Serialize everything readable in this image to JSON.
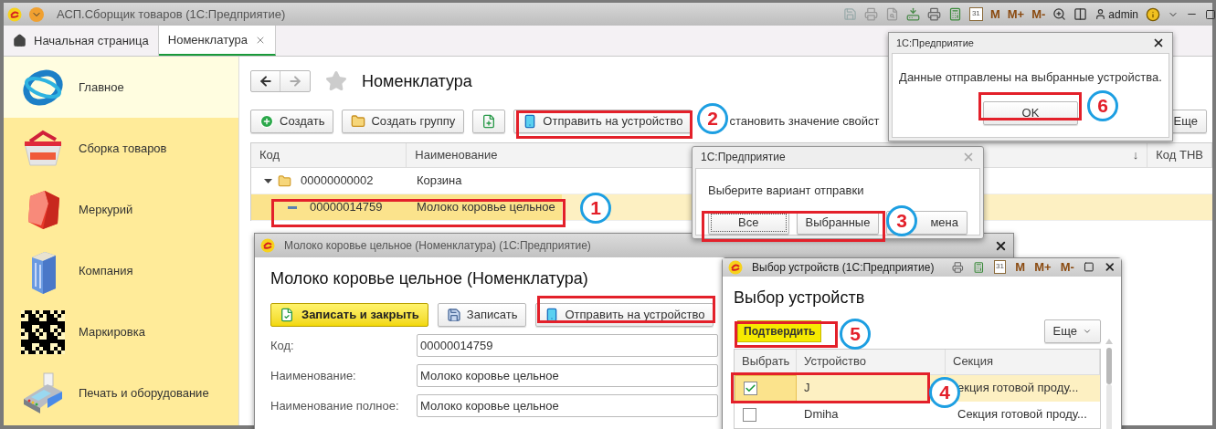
{
  "app_window": {
    "title": "АСП.Сборщик товаров  (1С:Предприятие)",
    "calendar_day": "31",
    "memory_keys": [
      "M",
      "M+",
      "M-"
    ],
    "user": "admin"
  },
  "tabs": [
    {
      "label": "Начальная страница",
      "selected": false,
      "kind": "home"
    },
    {
      "label": "Номенклатура",
      "selected": true,
      "kind": "page"
    }
  ],
  "sidebar": {
    "items": [
      {
        "label": "Главное",
        "selected": true,
        "kind": "globe"
      },
      {
        "label": "Сборка товаров",
        "selected": false,
        "kind": "basket"
      },
      {
        "label": "Меркурий",
        "selected": false,
        "kind": "cube"
      },
      {
        "label": "Компания",
        "selected": false,
        "kind": "building"
      },
      {
        "label": "Маркировка",
        "selected": false,
        "kind": "code"
      },
      {
        "label": "Печать и оборудование",
        "selected": false,
        "kind": "terminal"
      }
    ]
  },
  "list_form": {
    "title": "Номенклатура",
    "toolbar": [
      {
        "label": "Создать",
        "kind": "create"
      },
      {
        "label": "Создать группу",
        "kind": "group"
      },
      {
        "kind": "copy"
      },
      {
        "label": "Отправить на устройство",
        "kind": "send"
      },
      {
        "label": "становить значение свойст",
        "kind": "plain"
      }
    ],
    "more": "Еще",
    "columns": [
      {
        "label": "Код"
      },
      {
        "label": "Наименование",
        "sort": "↓"
      },
      {
        "label": "Код ТНВ"
      }
    ],
    "rows": [
      {
        "code": "00000000002",
        "name": "Корзина",
        "kind": "group",
        "expanded": true,
        "selected": false,
        "children": [
          {
            "code": "00000014759",
            "name": "Молоко коровье цельное",
            "kind": "item",
            "selected": true
          }
        ]
      }
    ]
  },
  "item_window": {
    "title": "Молоко коровье цельное (Номенклатура)  (1С:Предприятие)",
    "heading": "Молоко коровье цельное (Номенклатура)",
    "buttons": [
      {
        "label": "Записать и закрыть",
        "kind": "primary"
      },
      {
        "label": "Записать",
        "kind": "save"
      },
      {
        "label": "Отправить на устройство",
        "kind": "send"
      }
    ],
    "fields": [
      {
        "label": "Код:",
        "value": "00000014759"
      },
      {
        "label": "Наименование:",
        "value": "Молоко коровье цельное"
      },
      {
        "label": "Наименование полное:",
        "value": "Молоко коровье цельное"
      }
    ]
  },
  "choice_dialog": {
    "title": "1С:Предприятие",
    "message": "Выберите вариант отправки",
    "buttons": [
      {
        "label": "Все",
        "focused": true
      },
      {
        "label": "Выбранные",
        "focused": false
      },
      {
        "label": "мена",
        "focused": false
      }
    ]
  },
  "devices_window": {
    "title": "Выбор устройств  (1С:Предприятие)",
    "calendar_day": "31",
    "memory_keys": [
      "M",
      "M+",
      "M-"
    ],
    "heading": "Выбор устройств",
    "confirm": "Подтвердить",
    "more": "Еще",
    "columns": [
      "Выбрать",
      "Устройство",
      "Секция"
    ],
    "rows": [
      {
        "checked": true,
        "device": "J",
        "section": "екция готовой проду...",
        "selected": true
      },
      {
        "checked": false,
        "device": "Dmiha",
        "section": "Секция готовой проду...",
        "selected": false
      }
    ]
  },
  "message_dialog": {
    "title": "1С:Предприятие",
    "message": "Данные отправлены на выбранные устройства.",
    "button": "OK"
  },
  "markers": [
    {
      "number": "1"
    },
    {
      "number": "2"
    },
    {
      "number": "3"
    },
    {
      "number": "4"
    },
    {
      "number": "5"
    },
    {
      "number": "6"
    }
  ]
}
